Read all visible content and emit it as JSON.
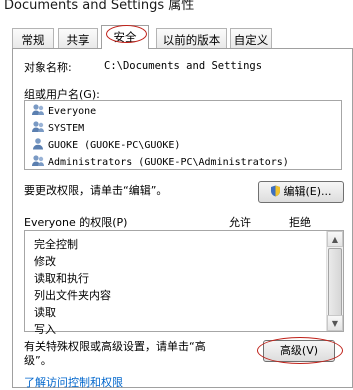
{
  "window": {
    "title": "Documents and Settings 属性"
  },
  "tabs": [
    {
      "label": "常规"
    },
    {
      "label": "共享"
    },
    {
      "label": "安全"
    },
    {
      "label": "以前的版本"
    },
    {
      "label": "自定义"
    }
  ],
  "object": {
    "label": "对象名称:",
    "value": "C:\\Documents and Settings"
  },
  "users": {
    "label": "组或用户名(G):",
    "items": [
      {
        "name": "Everyone"
      },
      {
        "name": "SYSTEM"
      },
      {
        "name": "GUOKE (GUOKE-PC\\GUOKE)"
      },
      {
        "name": "Administrators (GUOKE-PC\\Administrators)"
      }
    ]
  },
  "edit": {
    "hint": "要更改权限，请单击“编辑”。",
    "button_label": "编辑(E)..."
  },
  "permissions": {
    "header": "Everyone 的权限(P)",
    "allow_label": "允许",
    "deny_label": "拒绝",
    "items": [
      {
        "name": "完全控制"
      },
      {
        "name": "修改"
      },
      {
        "name": "读取和执行"
      },
      {
        "name": "列出文件夹内容"
      },
      {
        "name": "读取"
      },
      {
        "name": "写入"
      }
    ]
  },
  "advanced": {
    "hint_line1": "有关特殊权限或高级设置，请单击“高",
    "hint_line2": "级”。",
    "button_label": "高级(V)"
  },
  "link": {
    "text": "了解访问控制和权限"
  }
}
